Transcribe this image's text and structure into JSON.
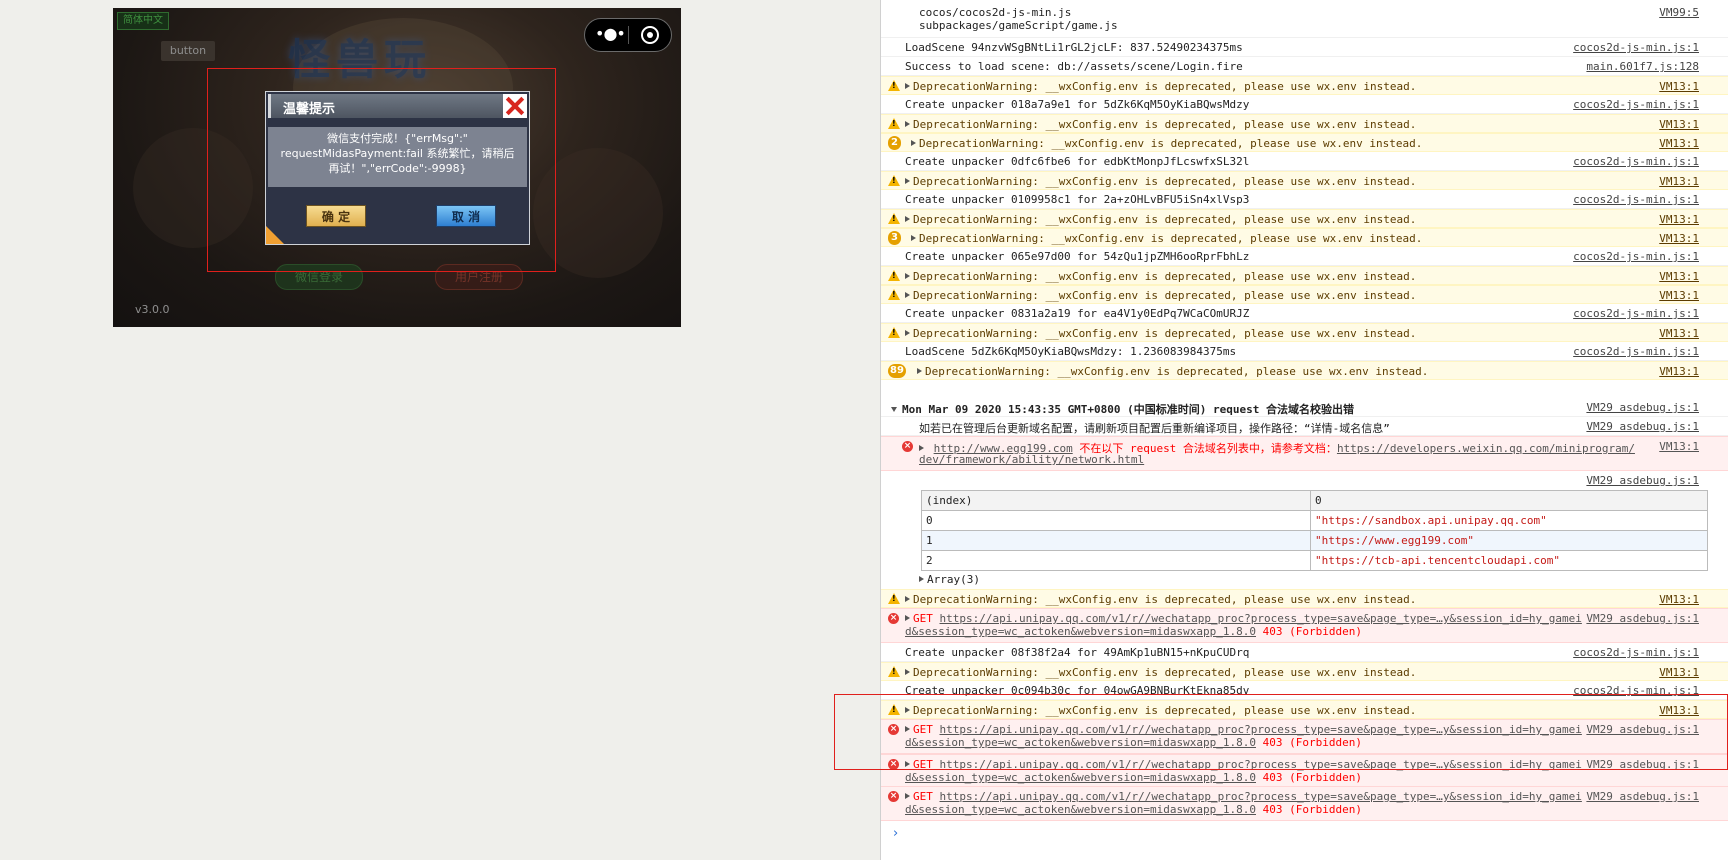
{
  "simulator": {
    "lang_button": "简体中文",
    "test_button": "button",
    "logo_text": "怪兽玩",
    "wechat_login": "微信登录",
    "register": "用户注册",
    "version": "v3.0.0",
    "dialog": {
      "title": "温馨提示",
      "message_line1": "微信支付完成！{\"errMsg\":\"",
      "message_line2": "requestMidasPayment:fail 系统繁忙，请稍后",
      "message_line3": "再试！\",\"errCode\":-9998}",
      "confirm": "确 定",
      "cancel": "取 消"
    },
    "capsule_dots": "•●•"
  },
  "console": {
    "rows": [
      {
        "type": "log",
        "msg": "cocos/cocos2d-js-min.js",
        "msg2": "subpackages/gameScript/game.js",
        "src": "VM99:5"
      },
      {
        "type": "log",
        "msg": "LoadScene 94nzvWSgBNtLi1rGL2jcLF: 837.52490234375ms",
        "src": "cocos2d-js-min.js:1"
      },
      {
        "type": "log",
        "msg": "Success to load scene: db://assets/scene/Login.fire",
        "src": "main.601f7.js:128"
      },
      {
        "type": "warn",
        "msg": "DeprecationWarning: __wxConfig.env is deprecated, please use wx.env instead.",
        "src": "VM13:1"
      },
      {
        "type": "log",
        "msg": "Create unpacker 018a7a9e1 for 5dZk6KqM5OyKiaBQwsMdzy",
        "src": "cocos2d-js-min.js:1"
      },
      {
        "type": "warn",
        "msg": "DeprecationWarning: __wxConfig.env is deprecated, please use wx.env instead.",
        "src": "VM13:1"
      },
      {
        "type": "warn",
        "count": "2",
        "msg": "DeprecationWarning: __wxConfig.env is deprecated, please use wx.env instead.",
        "src": "VM13:1"
      },
      {
        "type": "log",
        "msg": "Create unpacker 0dfc6fbe6 for edbKtMonpJfLcswfxSL32l",
        "src": "cocos2d-js-min.js:1"
      },
      {
        "type": "warn",
        "msg": "DeprecationWarning: __wxConfig.env is deprecated, please use wx.env instead.",
        "src": "VM13:1"
      },
      {
        "type": "log",
        "msg": "Create unpacker 0109958c1 for 2a+zOHLvBFU5iSn4xlVsp3",
        "src": "cocos2d-js-min.js:1"
      },
      {
        "type": "warn",
        "msg": "DeprecationWarning: __wxConfig.env is deprecated, please use wx.env instead.",
        "src": "VM13:1"
      },
      {
        "type": "warn",
        "count": "3",
        "msg": "DeprecationWarning: __wxConfig.env is deprecated, please use wx.env instead.",
        "src": "VM13:1"
      },
      {
        "type": "log",
        "msg": "Create unpacker 065e97d00 for 54zQu1jpZMH6ooRprFbhLz",
        "src": "cocos2d-js-min.js:1"
      },
      {
        "type": "warn",
        "msg": "DeprecationWarning: __wxConfig.env is deprecated, please use wx.env instead.",
        "src": "VM13:1"
      },
      {
        "type": "warn",
        "msg": "DeprecationWarning: __wxConfig.env is deprecated, please use wx.env instead.",
        "src": "VM13:1"
      },
      {
        "type": "log",
        "msg": "Create unpacker 0831a2a19 for ea4V1y0EdPq7WCaCOmURJZ",
        "src": "cocos2d-js-min.js:1"
      },
      {
        "type": "warn",
        "msg": "DeprecationWarning: __wxConfig.env is deprecated, please use wx.env instead.",
        "src": "VM13:1"
      },
      {
        "type": "log",
        "msg": "LoadScene 5dZk6KqM5OyKiaBQwsMdzy: 1.236083984375ms",
        "src": "cocos2d-js-min.js:1"
      },
      {
        "type": "warn",
        "count": "89",
        "msg": "DeprecationWarning: __wxConfig.env is deprecated, please use wx.env instead.",
        "src": "VM13:1"
      }
    ],
    "group_header": "Mon Mar 09 2020 15:43:35 GMT+0800 (中国标准时间) request 合法域名校验出错",
    "group_header_src": "VM29 asdebug.js:1",
    "group_info": "如若已在管理后台更新域名配置，请刷新项目配置后重新编译项目，操作路径：“详情-域名信息”",
    "group_info_src": "VM29 asdebug.js:1",
    "domain_err_url": "http://www.egg199.com",
    "domain_err_text": "不在以下 request 合法域名列表中，请参考文档：",
    "domain_err_doc": "https://developers.weixin.qq.com/miniprogram/",
    "domain_err_doc2": "dev/framework/ability/network.html",
    "domain_err_src": "VM13:1",
    "table_src": "VM29 asdebug.js:1",
    "table": {
      "headers": [
        "(index)",
        "0"
      ],
      "rows": [
        [
          "0",
          "\"https://sandbox.api.unipay.qq.com\""
        ],
        [
          "1",
          "\"https://www.egg199.com\""
        ],
        [
          "2",
          "\"https://tcb-api.tencentcloudapi.com\""
        ]
      ],
      "footer": "Array(3)"
    },
    "rows2": [
      {
        "type": "warn",
        "msg": "DeprecationWarning: __wxConfig.env is deprecated, please use wx.env instead.",
        "src": "VM13:1"
      },
      {
        "type": "err",
        "method": "GET",
        "url": "https://api.unipay.qq.com/v1/r//wechatapp_proc?process_type=save&page_type=…y&session_id=hy_gamei",
        "url2": "d&session_type=wc_actoken&webversion=midaswxapp_1.8.0",
        "status": "403 (Forbidden)",
        "src": "VM29 asdebug.js:1"
      },
      {
        "type": "log",
        "msg": "Create unpacker 08f38f2a4 for 49AmKp1uBN15+nKpuCUDrq",
        "src": "cocos2d-js-min.js:1"
      },
      {
        "type": "warn",
        "msg": "DeprecationWarning: __wxConfig.env is deprecated, please use wx.env instead.",
        "src": "VM13:1"
      },
      {
        "type": "log",
        "msg": "Create unpacker 0c094b30c for 04owGA9BNBurKtEkna85dv",
        "src": "cocos2d-js-min.js:1"
      },
      {
        "type": "warn",
        "msg": "DeprecationWarning: __wxConfig.env is deprecated, please use wx.env instead.",
        "src": "VM13:1"
      },
      {
        "type": "err",
        "method": "GET",
        "url": "https://api.unipay.qq.com/v1/r//wechatapp_proc?process_type=save&page_type=…y&session_id=hy_gamei",
        "url2": "d&session_type=wc_actoken&webversion=midaswxapp_1.8.0",
        "status": "403 (Forbidden)",
        "src": "VM29 asdebug.js:1"
      },
      {
        "type": "err",
        "method": "GET",
        "url": "https://api.unipay.qq.com/v1/r//wechatapp_proc?process_type=save&page_type=…y&session_id=hy_gamei",
        "url2": "d&session_type=wc_actoken&webversion=midaswxapp_1.8.0",
        "status": "403 (Forbidden)",
        "src": "VM29 asdebug.js:1"
      },
      {
        "type": "err",
        "method": "GET",
        "url": "https://api.unipay.qq.com/v1/r//wechatapp_proc?process_type=save&page_type=…y&session_id=hy_gamei",
        "url2": "d&session_type=wc_actoken&webversion=midaswxapp_1.8.0",
        "status": "403 (Forbidden)",
        "src": "VM29 asdebug.js:1"
      }
    ],
    "prompt": "›"
  },
  "colors": {
    "highlight": "#e0201c",
    "warn_bg": "#fffbe5",
    "err_bg": "#fff0f0",
    "link_blue": "#2a6fd6"
  }
}
